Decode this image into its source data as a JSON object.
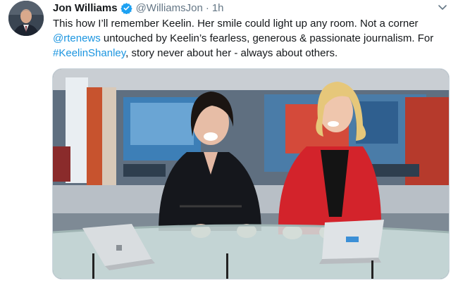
{
  "tweet": {
    "author_name": "Jon Williams",
    "handle": "@WilliamsJon",
    "separator": "·",
    "time": "1h",
    "text_parts": {
      "t1": "This how I’ll remember Keelin. Her smile could light up any room. Not a corner ",
      "mention": "@rtenews",
      "t2": " untouched by Keelin’s fearless, generous & passionate journalism. For ",
      "hashtag": "#KeelinShanley",
      "t3": ", story never about her - always about others."
    }
  },
  "icons": {
    "verified": "verified-badge-icon",
    "caret": "chevron-down-icon"
  },
  "colors": {
    "link": "#1b95e0",
    "secondary_text": "#657786",
    "verified_blue": "#1da1f2"
  }
}
